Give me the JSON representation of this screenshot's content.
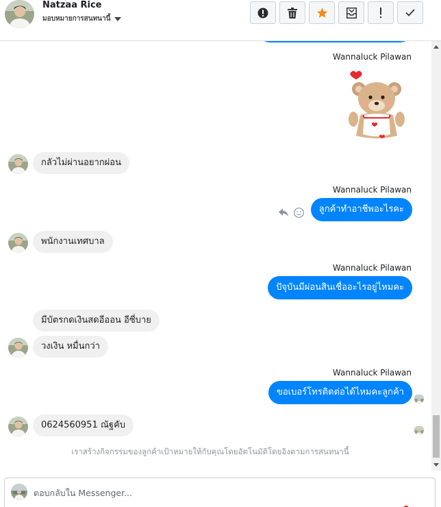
{
  "header": {
    "contact_name": "Natzaa Rice",
    "assign_label": "มอบหมายการสนทนานี้",
    "toolbar": [
      {
        "name": "mark-spam-button",
        "icon": "alert-circle-icon"
      },
      {
        "name": "delete-button",
        "icon": "trash-icon"
      },
      {
        "name": "star-button",
        "icon": "star-icon",
        "color": "#f28b1a"
      },
      {
        "name": "move-to-inbox-button",
        "icon": "inbox-tray-icon"
      },
      {
        "name": "follow-up-button",
        "icon": "exclamation-icon"
      },
      {
        "name": "mark-done-button",
        "icon": "checkmark-icon"
      }
    ]
  },
  "colors": {
    "outgoing_bubble": "#0084ff",
    "incoming_bubble": "#f1f0f0",
    "star": "#f28b1a"
  },
  "messages": [
    {
      "direction": "out",
      "sender": "Wannaluck Pilawan",
      "type": "sticker",
      "sticker": "teddy-bear-heart-sticker"
    },
    {
      "direction": "in",
      "text": "กลัวไม่ผ่านอยากผ่อน"
    },
    {
      "direction": "out",
      "sender": "Wannaluck Pilawan",
      "text": "ลูกค้าทำอาชีพอะไรคะ"
    },
    {
      "direction": "in",
      "text": "พนักงานเทศบาล"
    },
    {
      "direction": "out",
      "sender": "Wannaluck Pilawan",
      "text": "ปัจุบันมีผ่อนสินเชื่ออะไรอยู่ไหมคะ"
    },
    {
      "direction": "in",
      "text": "มีบัตรกดเงินสดอีออน อีซี่บาย"
    },
    {
      "direction": "in",
      "text": "วงเงิน หมื่นกว่า"
    },
    {
      "direction": "out",
      "sender": "Wannaluck Pilawan",
      "text": "ขอเบอร์โทรติดต่อได้ไหมคะลูกค้า"
    },
    {
      "direction": "in",
      "text": "0624560951 ณัฐคับ"
    }
  ],
  "system_note": "เราสร้างกิจกรรมของลูกค้าเป้าหมายให้กับคุณโดยอัตโนมัติโดยอิงตามการสนทนานี้",
  "composer": {
    "placeholder": "ตอบกลับใน Messenger..."
  }
}
